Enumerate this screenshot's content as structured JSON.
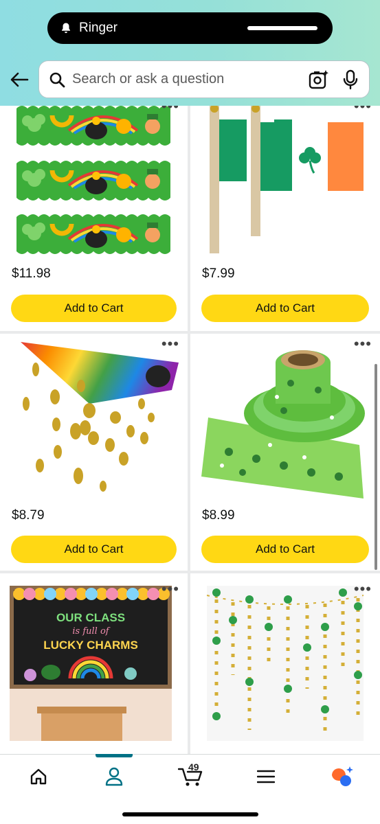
{
  "status": {
    "notification": "Ringer"
  },
  "search": {
    "placeholder": "Search or ask a question"
  },
  "products": [
    {
      "price": "$11.98",
      "cta": "Add to Cart",
      "image": "St. Patrick's Day scalloped bulletin border with shamrocks, rainbow, pot of gold and leprechaun"
    },
    {
      "price": "$7.99",
      "cta": "Add to Cart",
      "image": "Irish tricolor hand flags with shamrock"
    },
    {
      "price": "$8.79",
      "cta": "Add to Cart",
      "image": "Rainbow ceiling decoration with hanging gold coin strings"
    },
    {
      "price": "$8.99",
      "cta": "Add to Cart",
      "image": "Roll of green shamrock bulletin board border"
    },
    {
      "price": "",
      "cta": "",
      "image": "Classroom bulletin board"
    },
    {
      "price": "",
      "cta": "",
      "image": "Gold circle and shamrock garlands"
    }
  ],
  "bulletin": {
    "line1": "OUR CLASS",
    "line2": "is full of",
    "line3": "LUCKY CHARMS"
  },
  "nav": {
    "cart_count": "49",
    "items": [
      "home-icon",
      "account-icon",
      "cart-icon",
      "menu-icon",
      "rufus-icon"
    ],
    "active_index": 1,
    "accent": "#007185"
  },
  "colors": {
    "button": "#ffd814",
    "header_start": "#8fdde2",
    "header_end": "#a6e6d1"
  }
}
